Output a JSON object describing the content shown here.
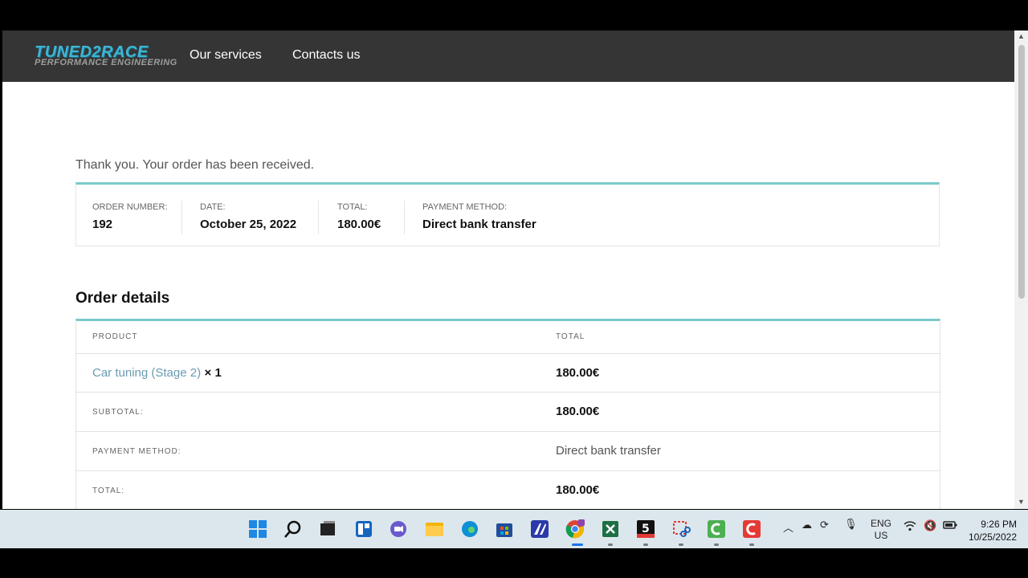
{
  "site": {
    "logo_main": "TUNED2RACE",
    "logo_sub": "PERFORMANCE ENGINEERING",
    "nav": [
      "Our services",
      "Contacts us"
    ]
  },
  "order": {
    "thank_you": "Thank you. Your order has been received.",
    "overview": {
      "number_label": "ORDER NUMBER:",
      "number": "192",
      "date_label": "DATE:",
      "date": "October 25, 2022",
      "total_label": "TOTAL:",
      "total": "180.00€",
      "method_label": "PAYMENT METHOD:",
      "method": "Direct bank transfer"
    },
    "details_title": "Order details",
    "table": {
      "head_product": "PRODUCT",
      "head_total": "TOTAL",
      "product_name": "Car tuning (Stage 2)",
      "product_qty": "× 1",
      "product_total": "180.00€",
      "subtotal_label": "SUBTOTAL:",
      "subtotal": "180.00€",
      "payment_label": "PAYMENT METHOD:",
      "payment": "Direct bank transfer",
      "total_label": "TOTAL:",
      "total": "180.00€"
    }
  },
  "taskbar": {
    "language": "ENG",
    "region": "US",
    "time": "9:26 PM",
    "date": "10/25/2022",
    "colors": {
      "accent": "#7bc9c9",
      "header": "#353535",
      "link": "#6b9bb1"
    }
  }
}
